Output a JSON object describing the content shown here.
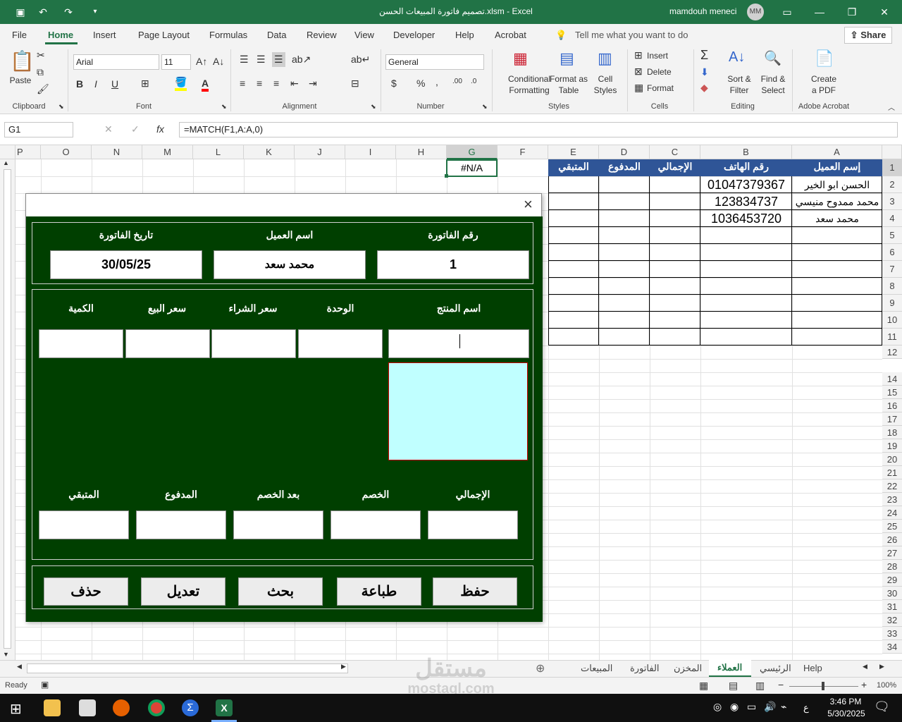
{
  "window": {
    "title": "تصميم فاتورة المبيعات الحسن.xlsm  -  Excel",
    "user": "mamdouh meneci",
    "user_initials": "MM"
  },
  "menu": [
    "File",
    "Home",
    "Insert",
    "Page Layout",
    "Formulas",
    "Data",
    "Review",
    "View",
    "Developer",
    "Help",
    "Acrobat"
  ],
  "tell_me": "Tell me what you want to do",
  "share": "Share",
  "ribbon": {
    "paste": "Paste",
    "font_name": "Arial",
    "font_size": "11",
    "number_format": "General",
    "conditional_formatting_1": "Conditional",
    "conditional_formatting_2": "Formatting",
    "format_as_table_1": "Format as",
    "format_as_table_2": "Table",
    "cell_styles_1": "Cell",
    "cell_styles_2": "Styles",
    "insert": "Insert",
    "delete": "Delete",
    "format": "Format",
    "sort_filter_1": "Sort &",
    "sort_filter_2": "Filter",
    "find_select_1": "Find &",
    "find_select_2": "Select",
    "create_pdf_1": "Create",
    "create_pdf_2": "a PDF",
    "groups": {
      "clipboard": "Clipboard",
      "font": "Font",
      "alignment": "Alignment",
      "number": "Number",
      "styles": "Styles",
      "cells": "Cells",
      "editing": "Editing",
      "acrobat": "Adobe Acrobat"
    },
    "bold": "B",
    "italic": "I",
    "underline": "U"
  },
  "formula_bar": {
    "name_box": "G1",
    "fx": "fx",
    "formula": "=MATCH(F1,A:A,0)"
  },
  "sheet": {
    "columns": [
      "A",
      "B",
      "C",
      "D",
      "E",
      "F",
      "G",
      "H",
      "I",
      "J",
      "K",
      "L",
      "M",
      "N",
      "O",
      "P"
    ],
    "rows": [
      "1",
      "2",
      "3",
      "4",
      "5",
      "6",
      "7",
      "8",
      "9",
      "10",
      "11",
      "12",
      "14",
      "15",
      "16",
      "17",
      "18",
      "19",
      "20",
      "21",
      "22",
      "23",
      "24",
      "25",
      "26",
      "27",
      "28",
      "29",
      "30",
      "31",
      "32",
      "33",
      "34"
    ],
    "headers": {
      "A": "إسم العميل",
      "B": "رقم الهاتف",
      "C": "الإجمالي",
      "D": "المدفوع",
      "E": "المتبقي"
    },
    "data": [
      {
        "name": "الحسن ابو الخير",
        "phone": "01047379367"
      },
      {
        "name": "محمد ممدوح منيسي",
        "phone": "123834737"
      },
      {
        "name": "محمد سعد",
        "phone": "1036453720"
      }
    ],
    "g1": "#N/A"
  },
  "dialog": {
    "close": "×",
    "invoice_number_label": "رقم الفاتورة",
    "invoice_number": "1",
    "customer_label": "اسم العميل",
    "customer": "محمد سعد",
    "date_label": "تاريخ الفاتورة",
    "date": "30/05/25",
    "product_label": "اسم المنتج",
    "unit_label": "الوحدة",
    "buy_price_label": "سعر الشراء",
    "sell_price_label": "سعر البيع",
    "qty_label": "الكمية",
    "total_label": "الإجمالي",
    "discount_label": "الخصم",
    "after_discount_label": "بعد الخصم",
    "paid_label": "المدفوع",
    "remaining_label": "المتبقي",
    "buttons": {
      "save": "حفظ",
      "print": "طباعة",
      "search": "بحث",
      "edit": "تعديل",
      "delete": "حذف"
    }
  },
  "tabs": [
    "Help",
    "الرئيسي",
    "العملاء",
    "المخزن",
    "الفاتورة",
    "المبيعات"
  ],
  "active_tab": "العملاء",
  "status": {
    "ready": "Ready",
    "zoom": "100%"
  },
  "taskbar": {
    "time": "3:46 PM",
    "date": "5/30/2025",
    "lang": "ع"
  },
  "watermark": {
    "ar": "مستقل",
    "en": "mostaql.com"
  }
}
